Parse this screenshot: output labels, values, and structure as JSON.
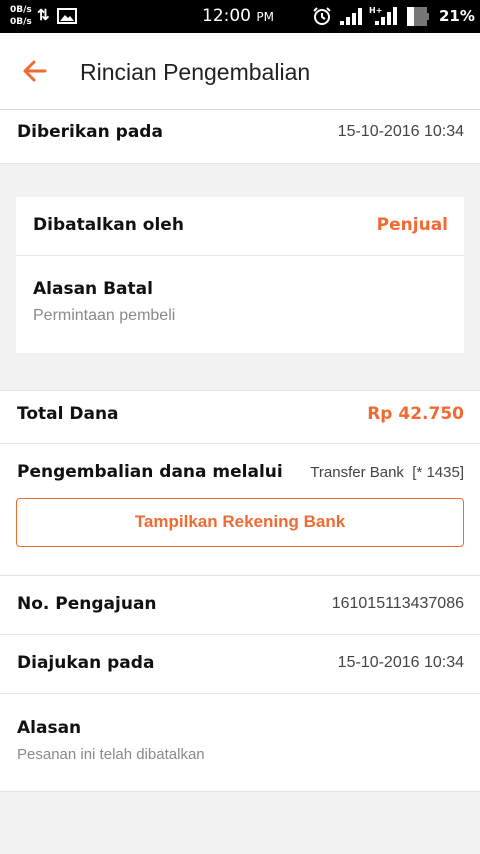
{
  "status_bar": {
    "speed_up": "0B/s",
    "speed_down": "0B/s",
    "time": "12:00",
    "ampm": "PM",
    "network_type": "H+",
    "battery_pct": "21%"
  },
  "header": {
    "title": "Rincian Pengembalian"
  },
  "given": {
    "label": "Diberikan pada",
    "value": "15-10-2016 10:34"
  },
  "cancel_card": {
    "by_label": "Dibatalkan oleh",
    "by_value": "Penjual",
    "reason_label": "Alasan Batal",
    "reason_value": "Permintaan pembeli"
  },
  "total": {
    "label": "Total Dana",
    "value": "Rp 42.750"
  },
  "refund": {
    "label": "Pengembalian dana melalui",
    "method": "Transfer Bank",
    "account": "[* 1435]",
    "button_label": "Tampilkan Rekening Bank"
  },
  "submission": {
    "label": "No. Pengajuan",
    "value": "161015113437086"
  },
  "submitted": {
    "label": "Diajukan pada",
    "value": "15-10-2016 10:34"
  },
  "reason": {
    "label": "Alasan",
    "value": "Pesanan ini telah dibatalkan"
  },
  "colors": {
    "accent": "#f26a33",
    "background": "#f2f2f2"
  }
}
